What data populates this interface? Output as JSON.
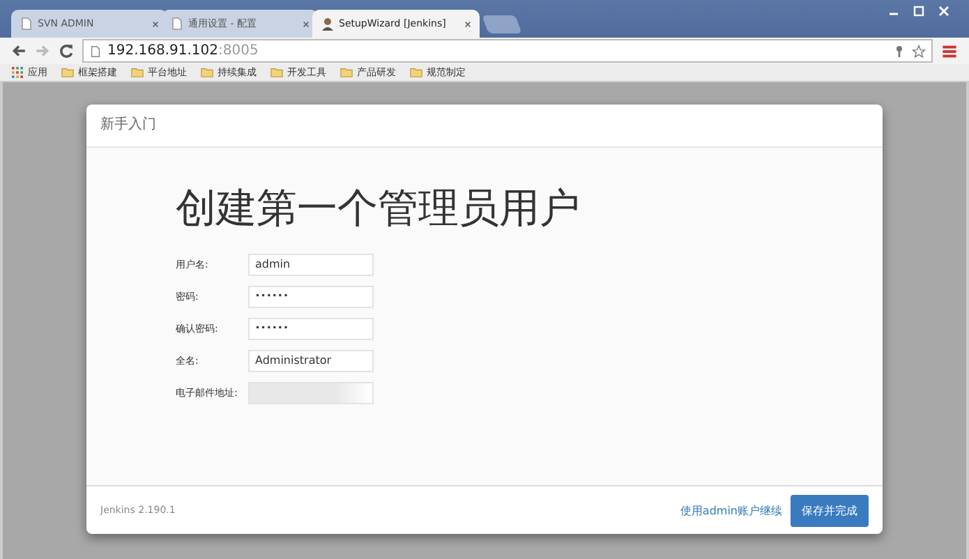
{
  "tabs": [
    {
      "title": "SVN ADMIN",
      "selected": false
    },
    {
      "title": "通用设置 - 配置",
      "selected": false
    },
    {
      "title": "SetupWizard [Jenkins]",
      "selected": true
    }
  ],
  "address": {
    "host": "192.168.91.102",
    "port": ":8005"
  },
  "bookmarks": [
    {
      "label": "应用",
      "kind": "apps"
    },
    {
      "label": "框架搭建",
      "kind": "folder"
    },
    {
      "label": "平台地址",
      "kind": "folder"
    },
    {
      "label": "持续集成",
      "kind": "folder"
    },
    {
      "label": "开发工具",
      "kind": "folder"
    },
    {
      "label": "产品研发",
      "kind": "folder"
    },
    {
      "label": "规范制定",
      "kind": "folder"
    }
  ],
  "dialog": {
    "header": "新手入门",
    "heading": "创建第一个管理员用户",
    "fields": [
      {
        "label": "用户名:",
        "value": "admin",
        "kind": "text"
      },
      {
        "label": "密码:",
        "value": "••••••",
        "kind": "password"
      },
      {
        "label": "确认密码:",
        "value": "••••••",
        "kind": "password"
      },
      {
        "label": "全名:",
        "value": "Administrator",
        "kind": "text"
      },
      {
        "label": "电子邮件地址:",
        "kind": "blurred"
      }
    ],
    "version": "Jenkins 2.190.1",
    "link": "使用admin账户继续",
    "button": "保存并完成"
  }
}
